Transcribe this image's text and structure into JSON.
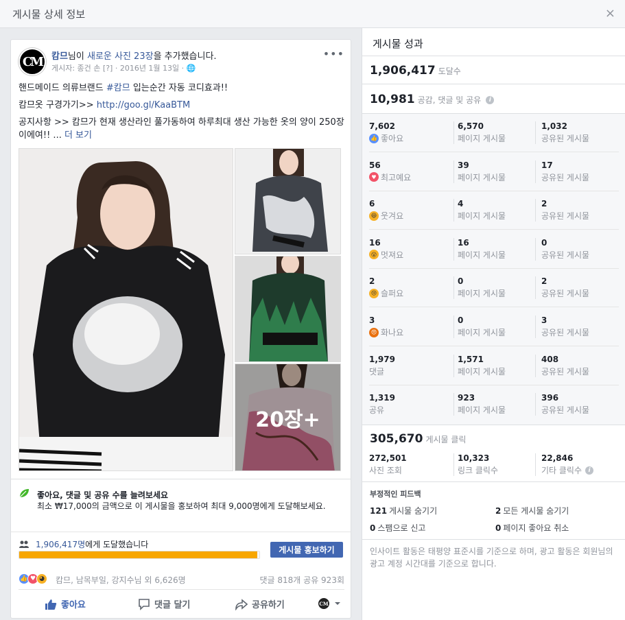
{
  "dialog": {
    "title": "게시물 상세 정보",
    "close_label": "×"
  },
  "post": {
    "author": "캄므",
    "headline_mid": "님이 ",
    "headline_link": "새로운 사진 23장",
    "headline_end": "을 추가했습니다.",
    "avatar_text": "CM",
    "sub": "게시자: 종건 손 [?] · 2016년 1월 13일 · 🌐",
    "menu_label": "•••",
    "body": {
      "line1_pre": "핸드메이드 의류브랜드 ",
      "line1_hashtag": "#캄므",
      "line1_post": " 입는순간 자동 코디효과!!",
      "line2_pre": "캄므옷 구경가기>> ",
      "line2_url": "http://goo.gl/KaaBTM",
      "line3": "공지사항 >> 캄므가 현재 생산라인 풀가동하여 하루최대 생산 가능한 옷의 양이 250장이에여!! ... ",
      "line3_more": "더 보기"
    },
    "photos_more_label": "20장+"
  },
  "promo": {
    "title": "좋아요, 댓글 및 공유 수를 늘려보세요",
    "desc": "최소 ₩17,000의 금액으로 이 게시물을 홍보하여 최대 9,000명에게 도달해보세요.",
    "reach_num": "1,906,417명",
    "reach_text": "에게 도달했습니다",
    "progress_fraction": 0.99,
    "boost_label": "게시물 홍보하기",
    "colors": {
      "progress": "#f7a600",
      "button": "#4267b2"
    }
  },
  "reactions": {
    "names": "캄므, 남목부일, 강지수님 외 6,626명",
    "right": "댓글 818개   공유 923회"
  },
  "actions": {
    "like": "좋아요",
    "comment": "댓글 달기",
    "share": "공유하기"
  },
  "insights": {
    "title": "게시물 성과",
    "reach_num": "1,906,417",
    "reach_label": "도달수",
    "engage_num": "10,981",
    "engage_label": "공감, 댓글 및 공유",
    "rows": [
      {
        "n1": "7,602",
        "l1": "좋아요",
        "emoji": "like",
        "n2": "6,570",
        "l2": "페이지 게시물",
        "n3": "1,032",
        "l3": "공유된 게시물"
      },
      {
        "n1": "56",
        "l1": "최고예요",
        "emoji": "love",
        "n2": "39",
        "l2": "페이지 게시물",
        "n3": "17",
        "l3": "공유된 게시물"
      },
      {
        "n1": "6",
        "l1": "웃겨요",
        "emoji": "haha",
        "n2": "4",
        "l2": "페이지 게시물",
        "n3": "2",
        "l3": "공유된 게시물"
      },
      {
        "n1": "16",
        "l1": "멋져요",
        "emoji": "wow",
        "n2": "16",
        "l2": "페이지 게시물",
        "n3": "0",
        "l3": "공유된 게시물"
      },
      {
        "n1": "2",
        "l1": "슬퍼요",
        "emoji": "sad",
        "n2": "0",
        "l2": "페이지 게시물",
        "n3": "2",
        "l3": "공유된 게시물"
      },
      {
        "n1": "3",
        "l1": "화나요",
        "emoji": "angry",
        "n2": "0",
        "l2": "페이지 게시물",
        "n3": "3",
        "l3": "공유된 게시물"
      },
      {
        "n1": "1,979",
        "l1": "댓글",
        "emoji": "",
        "n2": "1,571",
        "l2": "페이지 게시물",
        "n3": "408",
        "l3": "공유된 게시물"
      },
      {
        "n1": "1,319",
        "l1": "공유",
        "emoji": "",
        "n2": "923",
        "l2": "페이지 게시물",
        "n3": "396",
        "l3": "공유된 게시물"
      }
    ],
    "clicks_num": "305,670",
    "clicks_label": "게시물 클릭",
    "click_cells": [
      {
        "n": "272,501",
        "l": "사진 조회"
      },
      {
        "n": "10,323",
        "l": "링크 클릭수"
      },
      {
        "n": "22,846",
        "l": "기타 클릭수"
      }
    ],
    "negative_title": "부정적인 피드백",
    "negative": [
      {
        "n": "121",
        "l": "게시물 숨기기"
      },
      {
        "n": "2",
        "l": "모든 게시물 숨기기"
      },
      {
        "n": "0",
        "l": "스팸으로 신고"
      },
      {
        "n": "0",
        "l": "페이지 좋아요 취소"
      }
    ],
    "footnote": "인사이트 활동은 태평양 표준시를 기준으로 하며, 광고 활동은 회원님의 광고 계정 시간대를 기준으로 합니다."
  }
}
